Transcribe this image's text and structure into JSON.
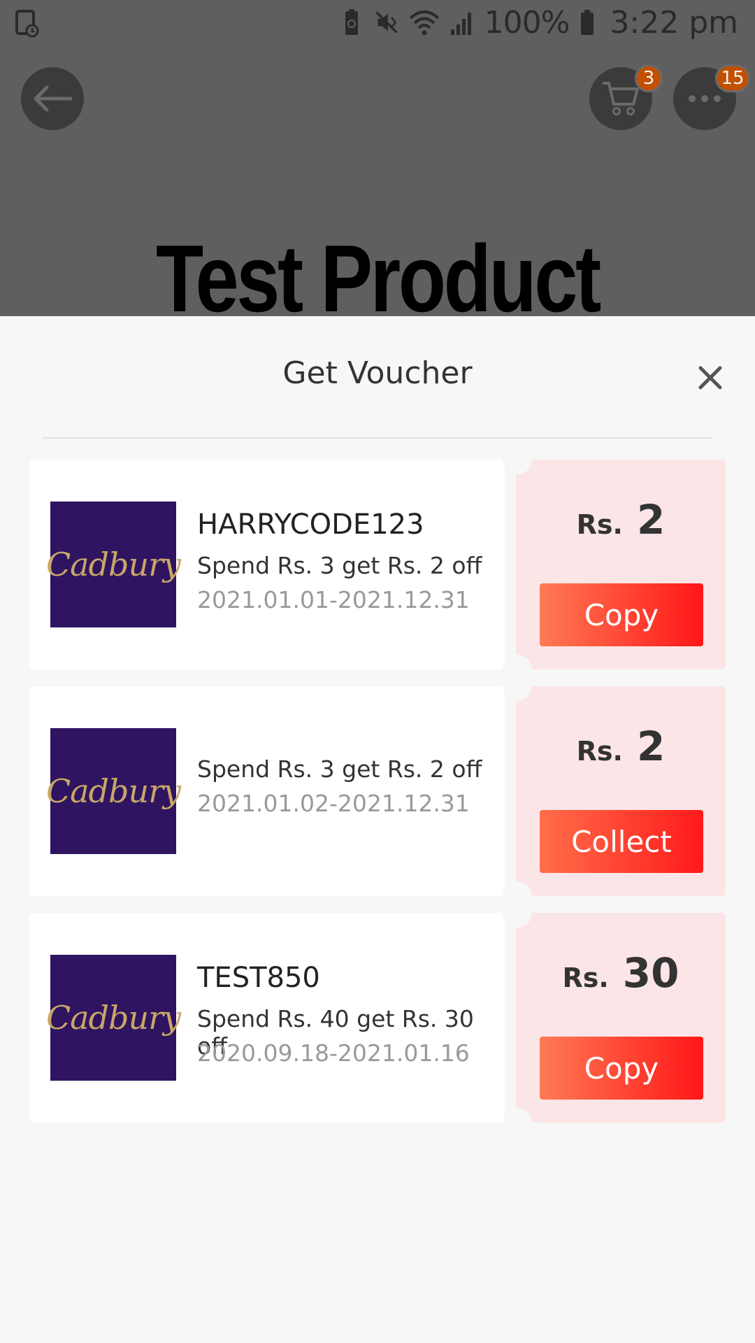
{
  "status_bar": {
    "battery_percent": "100%",
    "time": "3:22 pm"
  },
  "background_page": {
    "cart_count": "3",
    "more_count": "15",
    "product_title": "Test Product"
  },
  "sheet": {
    "title": "Get Voucher",
    "vouchers": [
      {
        "brand": "Cadbury",
        "code": "HARRYCODE123",
        "description": "Spend Rs. 3 get Rs. 2 off",
        "validity": "2021.01.01-2021.12.31",
        "currency": "Rs.",
        "amount": "2",
        "button_label": "Copy"
      },
      {
        "brand": "Cadbury",
        "code": "",
        "description": "Spend Rs. 3 get Rs. 2 off",
        "validity": "2021.01.02-2021.12.31",
        "currency": "Rs.",
        "amount": "2",
        "button_label": "Collect"
      },
      {
        "brand": "Cadbury",
        "code": "TEST850",
        "description": "Spend Rs. 40 get Rs. 30 off",
        "validity": "2020.09.18-2021.01.16",
        "currency": "Rs.",
        "amount": "30",
        "button_label": "Copy"
      }
    ]
  },
  "colors": {
    "overlay": "#5f5f5f",
    "badge": "#c25000",
    "button_start": "#ff7a55",
    "button_end": "#ff1717",
    "voucher_right_bg": "#fce5e6",
    "logo_bg": "#2f1461",
    "logo_text": "#c9a766"
  },
  "icons": [
    "screen-record-icon",
    "recycle-battery-icon",
    "mute-vibrate-icon",
    "wifi-icon",
    "signal-icon",
    "battery-icon",
    "back-arrow-icon",
    "cart-icon",
    "more-dots-icon",
    "close-icon"
  ]
}
